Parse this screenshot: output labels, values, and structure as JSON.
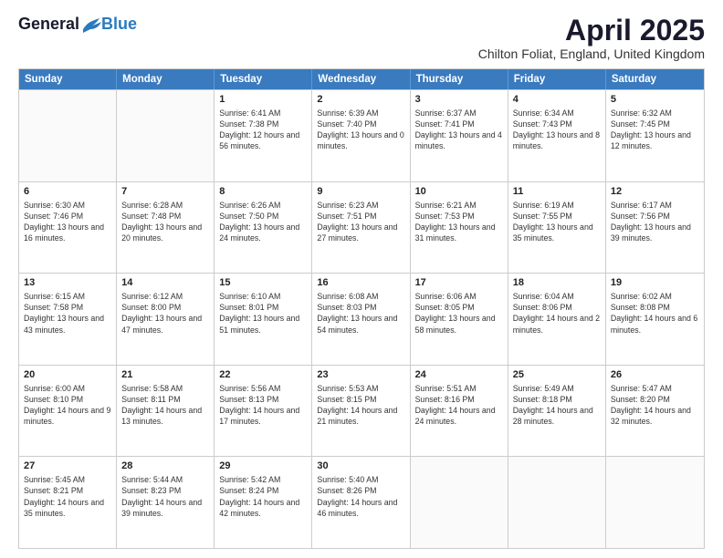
{
  "logo": {
    "general": "General",
    "blue": "Blue"
  },
  "title": "April 2025",
  "subtitle": "Chilton Foliat, England, United Kingdom",
  "days": [
    "Sunday",
    "Monday",
    "Tuesday",
    "Wednesday",
    "Thursday",
    "Friday",
    "Saturday"
  ],
  "weeks": [
    [
      {
        "day": "",
        "sunrise": "",
        "sunset": "",
        "daylight": ""
      },
      {
        "day": "",
        "sunrise": "",
        "sunset": "",
        "daylight": ""
      },
      {
        "day": "1",
        "sunrise": "Sunrise: 6:41 AM",
        "sunset": "Sunset: 7:38 PM",
        "daylight": "Daylight: 12 hours and 56 minutes."
      },
      {
        "day": "2",
        "sunrise": "Sunrise: 6:39 AM",
        "sunset": "Sunset: 7:40 PM",
        "daylight": "Daylight: 13 hours and 0 minutes."
      },
      {
        "day": "3",
        "sunrise": "Sunrise: 6:37 AM",
        "sunset": "Sunset: 7:41 PM",
        "daylight": "Daylight: 13 hours and 4 minutes."
      },
      {
        "day": "4",
        "sunrise": "Sunrise: 6:34 AM",
        "sunset": "Sunset: 7:43 PM",
        "daylight": "Daylight: 13 hours and 8 minutes."
      },
      {
        "day": "5",
        "sunrise": "Sunrise: 6:32 AM",
        "sunset": "Sunset: 7:45 PM",
        "daylight": "Daylight: 13 hours and 12 minutes."
      }
    ],
    [
      {
        "day": "6",
        "sunrise": "Sunrise: 6:30 AM",
        "sunset": "Sunset: 7:46 PM",
        "daylight": "Daylight: 13 hours and 16 minutes."
      },
      {
        "day": "7",
        "sunrise": "Sunrise: 6:28 AM",
        "sunset": "Sunset: 7:48 PM",
        "daylight": "Daylight: 13 hours and 20 minutes."
      },
      {
        "day": "8",
        "sunrise": "Sunrise: 6:26 AM",
        "sunset": "Sunset: 7:50 PM",
        "daylight": "Daylight: 13 hours and 24 minutes."
      },
      {
        "day": "9",
        "sunrise": "Sunrise: 6:23 AM",
        "sunset": "Sunset: 7:51 PM",
        "daylight": "Daylight: 13 hours and 27 minutes."
      },
      {
        "day": "10",
        "sunrise": "Sunrise: 6:21 AM",
        "sunset": "Sunset: 7:53 PM",
        "daylight": "Daylight: 13 hours and 31 minutes."
      },
      {
        "day": "11",
        "sunrise": "Sunrise: 6:19 AM",
        "sunset": "Sunset: 7:55 PM",
        "daylight": "Daylight: 13 hours and 35 minutes."
      },
      {
        "day": "12",
        "sunrise": "Sunrise: 6:17 AM",
        "sunset": "Sunset: 7:56 PM",
        "daylight": "Daylight: 13 hours and 39 minutes."
      }
    ],
    [
      {
        "day": "13",
        "sunrise": "Sunrise: 6:15 AM",
        "sunset": "Sunset: 7:58 PM",
        "daylight": "Daylight: 13 hours and 43 minutes."
      },
      {
        "day": "14",
        "sunrise": "Sunrise: 6:12 AM",
        "sunset": "Sunset: 8:00 PM",
        "daylight": "Daylight: 13 hours and 47 minutes."
      },
      {
        "day": "15",
        "sunrise": "Sunrise: 6:10 AM",
        "sunset": "Sunset: 8:01 PM",
        "daylight": "Daylight: 13 hours and 51 minutes."
      },
      {
        "day": "16",
        "sunrise": "Sunrise: 6:08 AM",
        "sunset": "Sunset: 8:03 PM",
        "daylight": "Daylight: 13 hours and 54 minutes."
      },
      {
        "day": "17",
        "sunrise": "Sunrise: 6:06 AM",
        "sunset": "Sunset: 8:05 PM",
        "daylight": "Daylight: 13 hours and 58 minutes."
      },
      {
        "day": "18",
        "sunrise": "Sunrise: 6:04 AM",
        "sunset": "Sunset: 8:06 PM",
        "daylight": "Daylight: 14 hours and 2 minutes."
      },
      {
        "day": "19",
        "sunrise": "Sunrise: 6:02 AM",
        "sunset": "Sunset: 8:08 PM",
        "daylight": "Daylight: 14 hours and 6 minutes."
      }
    ],
    [
      {
        "day": "20",
        "sunrise": "Sunrise: 6:00 AM",
        "sunset": "Sunset: 8:10 PM",
        "daylight": "Daylight: 14 hours and 9 minutes."
      },
      {
        "day": "21",
        "sunrise": "Sunrise: 5:58 AM",
        "sunset": "Sunset: 8:11 PM",
        "daylight": "Daylight: 14 hours and 13 minutes."
      },
      {
        "day": "22",
        "sunrise": "Sunrise: 5:56 AM",
        "sunset": "Sunset: 8:13 PM",
        "daylight": "Daylight: 14 hours and 17 minutes."
      },
      {
        "day": "23",
        "sunrise": "Sunrise: 5:53 AM",
        "sunset": "Sunset: 8:15 PM",
        "daylight": "Daylight: 14 hours and 21 minutes."
      },
      {
        "day": "24",
        "sunrise": "Sunrise: 5:51 AM",
        "sunset": "Sunset: 8:16 PM",
        "daylight": "Daylight: 14 hours and 24 minutes."
      },
      {
        "day": "25",
        "sunrise": "Sunrise: 5:49 AM",
        "sunset": "Sunset: 8:18 PM",
        "daylight": "Daylight: 14 hours and 28 minutes."
      },
      {
        "day": "26",
        "sunrise": "Sunrise: 5:47 AM",
        "sunset": "Sunset: 8:20 PM",
        "daylight": "Daylight: 14 hours and 32 minutes."
      }
    ],
    [
      {
        "day": "27",
        "sunrise": "Sunrise: 5:45 AM",
        "sunset": "Sunset: 8:21 PM",
        "daylight": "Daylight: 14 hours and 35 minutes."
      },
      {
        "day": "28",
        "sunrise": "Sunrise: 5:44 AM",
        "sunset": "Sunset: 8:23 PM",
        "daylight": "Daylight: 14 hours and 39 minutes."
      },
      {
        "day": "29",
        "sunrise": "Sunrise: 5:42 AM",
        "sunset": "Sunset: 8:24 PM",
        "daylight": "Daylight: 14 hours and 42 minutes."
      },
      {
        "day": "30",
        "sunrise": "Sunrise: 5:40 AM",
        "sunset": "Sunset: 8:26 PM",
        "daylight": "Daylight: 14 hours and 46 minutes."
      },
      {
        "day": "",
        "sunrise": "",
        "sunset": "",
        "daylight": ""
      },
      {
        "day": "",
        "sunrise": "",
        "sunset": "",
        "daylight": ""
      },
      {
        "day": "",
        "sunrise": "",
        "sunset": "",
        "daylight": ""
      }
    ]
  ]
}
